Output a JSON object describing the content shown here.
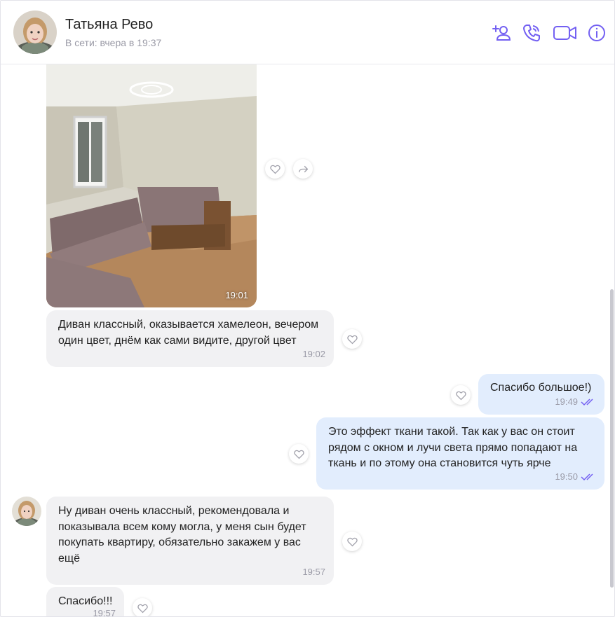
{
  "header": {
    "contact_name": "Татьяна Рево",
    "status": "В сети: вчера в 19:37",
    "icons": [
      "add-contact-icon",
      "phone-icon",
      "video-icon",
      "info-icon"
    ],
    "accent_color": "#7360f2"
  },
  "messages": [
    {
      "kind": "photo",
      "direction": "incoming",
      "time": "19:01"
    },
    {
      "kind": "text",
      "direction": "incoming",
      "text": "Диван классный, оказывается хамелеон, вечером\nодин цвет, днём как сами видите, другой цвет",
      "time": "19:02"
    },
    {
      "kind": "text",
      "direction": "outgoing",
      "text": "Спасибо большое!)",
      "time": "19:49",
      "status": "read"
    },
    {
      "kind": "text",
      "direction": "outgoing",
      "text": "Это эффект ткани такой. Так как у вас он стоит\nрядом с окном и лучи света прямо попадают на\nткань и по этому она становится чуть ярче",
      "time": "19:50",
      "status": "read"
    },
    {
      "kind": "text",
      "direction": "incoming",
      "text": "Ну диван очень классный, рекомендовала и\nпоказывала всем кому могла, у меня сын будет\nпокупать квартиру, обязательно закажем у вас\nещё",
      "time": "19:57"
    },
    {
      "kind": "text",
      "direction": "incoming",
      "text": "Спасибо!!!",
      "time": "19:57"
    }
  ]
}
